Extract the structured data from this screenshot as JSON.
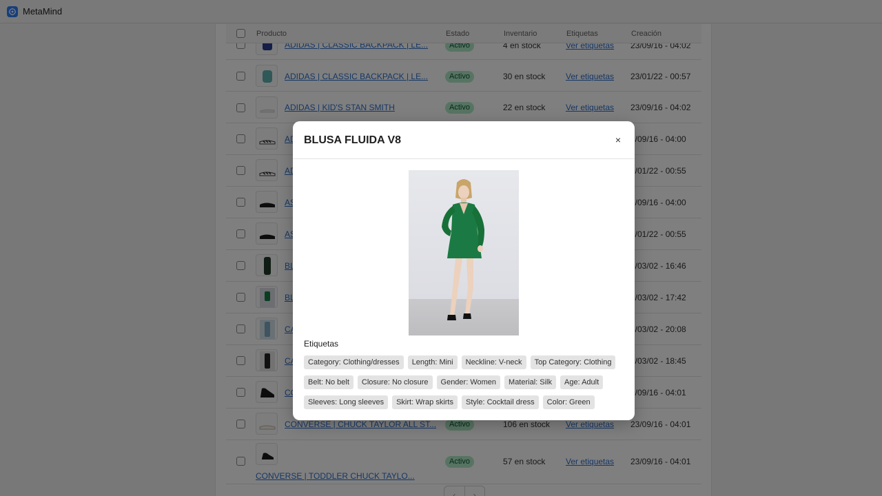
{
  "app": {
    "title": "MetaMind"
  },
  "table": {
    "headers": {
      "product": "Producto",
      "status": "Estado",
      "inventory": "Inventario",
      "tags": "Etiquetas",
      "created": "Creación"
    },
    "rows": [
      {
        "name": "ADIDAS | CLASSIC BACKPACK | LE...",
        "status": "Activo",
        "stock": "4 en stock",
        "tags_link": "Ver etiquetas",
        "date": "23/09/16 - 04:02"
      },
      {
        "name": "ADIDAS | CLASSIC BACKPACK | LE...",
        "status": "Activo",
        "stock": "30 en stock",
        "tags_link": "Ver etiquetas",
        "date": "23/01/22 - 00:57"
      },
      {
        "name": "ADIDAS | KID'S STAN SMITH",
        "status": "Activo",
        "stock": "22 en stock",
        "tags_link": "Ver etiquetas",
        "date": "23/09/16 - 04:02"
      },
      {
        "name": "AD",
        "date": "3/09/16 - 04:00"
      },
      {
        "name": "AD",
        "date": "3/01/22 - 00:55"
      },
      {
        "name": "AS",
        "date": "3/09/16 - 04:00"
      },
      {
        "name": "AS",
        "date": "3/01/22 - 00:55"
      },
      {
        "name": "BL",
        "date": "3/03/02 - 16:46"
      },
      {
        "name": "BL",
        "date": "3/03/02 - 17:42"
      },
      {
        "name": "CA",
        "date": "3/03/02 - 20:08"
      },
      {
        "name": "CA",
        "date": "3/03/02 - 18:45"
      },
      {
        "name": "CO",
        "date": "3/09/16 - 04:01"
      },
      {
        "name": "CONVERSE | CHUCK TAYLOR ALL ST...",
        "status": "Activo",
        "stock": "106 en stock",
        "tags_link": "Ver etiquetas",
        "date": "23/09/16 - 04:01"
      },
      {
        "name": "CONVERSE | TODDLER CHUCK TAYLO...",
        "status": "Activo",
        "stock": "57 en stock",
        "tags_link": "Ver etiquetas",
        "date": "23/09/16 - 04:01"
      }
    ]
  },
  "modal": {
    "title": "BLUSA FLUIDA V8",
    "close_symbol": "×",
    "tags_heading": "Etiquetas",
    "tags": [
      "Category: Clothing/dresses",
      "Length: Mini",
      "Neckline: V-neck",
      "Top Category: Clothing",
      "Belt: No belt",
      "Closure: No closure",
      "Gender: Women",
      "Material: Silk",
      "Age: Adult",
      "Sleeves: Long sleeves",
      "Skirt: Wrap skirts",
      "Style: Cocktail dress",
      "Color: Green"
    ]
  },
  "pager": {
    "prev": "‹",
    "next": "›"
  },
  "colors": {
    "accent": "#2c6ecb",
    "badge_bg": "#aee9c5",
    "dress": "#1b7a43",
    "logo": "#2f7df6"
  }
}
